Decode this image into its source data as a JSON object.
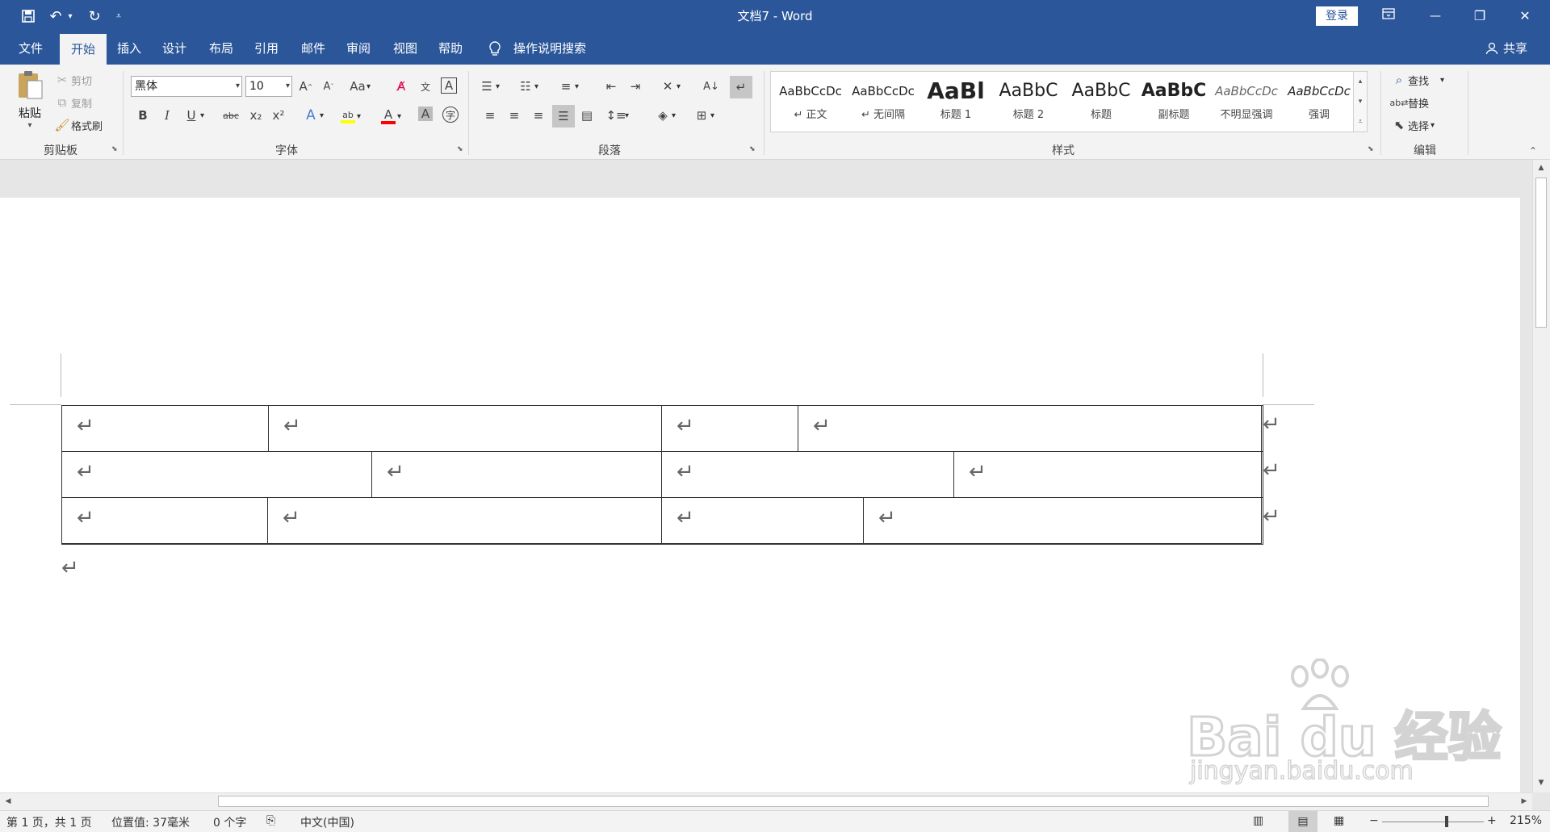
{
  "window": {
    "title": "文档7 - Word",
    "login": "登录",
    "controls": {
      "ribbon_display": "ribbon-display-icon",
      "minimize": "—",
      "restore": "❐",
      "close": "✕"
    }
  },
  "qat": {
    "save": "save-icon",
    "undo": "undo-icon",
    "redo": "redo-icon",
    "customize": "customize-icon"
  },
  "tabs": [
    "文件",
    "开始",
    "插入",
    "设计",
    "布局",
    "引用",
    "邮件",
    "审阅",
    "视图",
    "帮助"
  ],
  "active_tab": "开始",
  "tell_me": "操作说明搜索",
  "share": "共享",
  "clipboard": {
    "label": "剪贴板",
    "paste": "粘贴",
    "cut": "剪切",
    "copy": "复制",
    "format_painter": "格式刷"
  },
  "font": {
    "label": "字体",
    "family": "黑体",
    "size": "10",
    "buttons": {
      "bold": "B",
      "italic": "I",
      "underline": "U",
      "strike": "abc",
      "subscript": "x₂",
      "superscript": "x²",
      "font_color_sample": "A"
    },
    "colors": {
      "highlight": "#ffff00",
      "font_color": "#ff0000"
    }
  },
  "paragraph": {
    "label": "段落"
  },
  "styles": {
    "label": "样式",
    "items": [
      {
        "preview": "AaBbCcDc",
        "name": "↵ 正文"
      },
      {
        "preview": "AaBbCcDc",
        "name": "↵ 无间隔"
      },
      {
        "preview": "AaBl",
        "name": "标题 1"
      },
      {
        "preview": "AaBbC",
        "name": "标题 2"
      },
      {
        "preview": "AaBbC",
        "name": "标题"
      },
      {
        "preview": "AaBbC",
        "name": "副标题"
      },
      {
        "preview": "AaBbCcDc",
        "name": "不明显强调"
      },
      {
        "preview": "AaBbCcDc",
        "name": "强调"
      }
    ]
  },
  "editing": {
    "label": "编辑",
    "find": "查找",
    "replace": "替换",
    "select": "选择"
  },
  "document": {
    "paragraph_mark": "↵"
  },
  "status": {
    "page": "第 1 页，共 1 页",
    "position": "位置值: 37毫米",
    "words": "0 个字",
    "language": "中文(中国)",
    "zoom": "215%"
  },
  "watermark": {
    "brand": "Bai du 经验",
    "url": "jingyan.baidu.com"
  }
}
